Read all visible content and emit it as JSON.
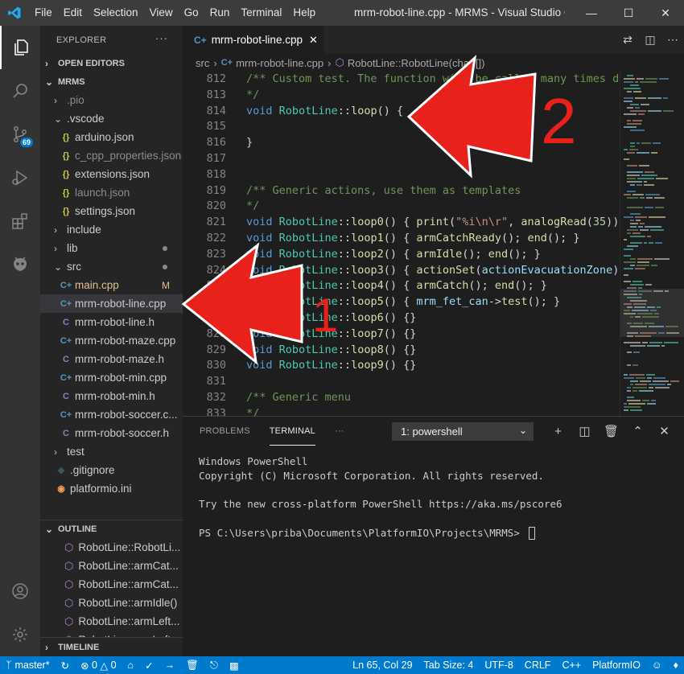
{
  "titlebar": {
    "menu": [
      "File",
      "Edit",
      "Selection",
      "View",
      "Go",
      "Run",
      "Terminal",
      "Help"
    ],
    "window_title": "mrm-robot-line.cpp - MRMS - Visual Studio C..."
  },
  "activitybar": {
    "scm_badge": "69",
    "icons": [
      "explorer-icon",
      "search-icon",
      "source-control-icon",
      "run-debug-icon",
      "extensions-icon",
      "platformio-icon"
    ]
  },
  "sidebar": {
    "header": "EXPLORER",
    "more": "···",
    "open_editors": "OPEN EDITORS",
    "project": "MRMS",
    "tree": [
      {
        "label": ".pio",
        "type": "folder",
        "indent": 1,
        "expanded": false
      },
      {
        "label": ".vscode",
        "type": "folder",
        "indent": 1,
        "expanded": true
      },
      {
        "label": "arduino.json",
        "type": "json",
        "indent": 2
      },
      {
        "label": "c_cpp_properties.json",
        "type": "json",
        "indent": 2
      },
      {
        "label": "extensions.json",
        "type": "json",
        "indent": 2
      },
      {
        "label": "launch.json",
        "type": "json",
        "indent": 2
      },
      {
        "label": "settings.json",
        "type": "json",
        "indent": 2
      },
      {
        "label": "include",
        "type": "folder",
        "indent": 1,
        "expanded": false
      },
      {
        "label": "lib",
        "type": "folder",
        "indent": 1,
        "expanded": false,
        "dot": true
      },
      {
        "label": "src",
        "type": "folder",
        "indent": 1,
        "expanded": true,
        "dot": true
      },
      {
        "label": "main.cpp",
        "type": "cpp",
        "indent": 2,
        "status": "M"
      },
      {
        "label": "mrm-robot-line.cpp",
        "type": "cpp",
        "indent": 2,
        "selected": true
      },
      {
        "label": "mrm-robot-line.h",
        "type": "h",
        "indent": 2
      },
      {
        "label": "mrm-robot-maze.cpp",
        "type": "cpp",
        "indent": 2
      },
      {
        "label": "mrm-robot-maze.h",
        "type": "h",
        "indent": 2
      },
      {
        "label": "mrm-robot-min.cpp",
        "type": "cpp",
        "indent": 2
      },
      {
        "label": "mrm-robot-min.h",
        "type": "h",
        "indent": 2
      },
      {
        "label": "mrm-robot-soccer.c...",
        "type": "cpp",
        "indent": 2
      },
      {
        "label": "mrm-robot-soccer.h",
        "type": "h",
        "indent": 2
      },
      {
        "label": "test",
        "type": "folder",
        "indent": 1,
        "expanded": false
      },
      {
        "label": ".gitignore",
        "type": "git",
        "indent": 1
      },
      {
        "label": "platformio.ini",
        "type": "ini",
        "indent": 1
      }
    ],
    "outline_title": "OUTLINE",
    "outline": [
      "RobotLine::RobotLi...",
      "RobotLine::armCat...",
      "RobotLine::armCat...",
      "RobotLine::armIdle()",
      "RobotLine::armLeft...",
      "RobotLine::armLeft..."
    ],
    "timeline_title": "TIMELINE"
  },
  "editor": {
    "tab_label": "mrm-robot-line.cpp",
    "tab_close": "✕",
    "breadcrumb": [
      "src",
      "mrm-robot-line.cpp",
      "RobotLine::RobotLine(char [])"
    ],
    "lines": [
      {
        "n": "812",
        "t": [
          [
            "cm",
            "/** Custom test. The function will be called many times du"
          ]
        ]
      },
      {
        "n": "813",
        "t": [
          [
            "cm",
            "*/"
          ]
        ]
      },
      {
        "n": "814",
        "t": [
          [
            "kw",
            "void "
          ],
          [
            "ty",
            "RobotLine"
          ],
          [
            "tx",
            "::"
          ],
          [
            "fn",
            "loop"
          ],
          [
            "tx",
            "() {"
          ]
        ]
      },
      {
        "n": "815",
        "t": []
      },
      {
        "n": "816",
        "t": [
          [
            "tx",
            "}"
          ]
        ]
      },
      {
        "n": "817",
        "t": []
      },
      {
        "n": "818",
        "t": []
      },
      {
        "n": "819",
        "t": [
          [
            "cm",
            "/** Generic actions, use them as templates"
          ]
        ]
      },
      {
        "n": "820",
        "t": [
          [
            "cm",
            "*/"
          ]
        ]
      },
      {
        "n": "821",
        "t": [
          [
            "kw",
            "void "
          ],
          [
            "ty",
            "RobotLine"
          ],
          [
            "tx",
            "::"
          ],
          [
            "fn",
            "loop0"
          ],
          [
            "tx",
            "() { "
          ],
          [
            "fn",
            "print"
          ],
          [
            "tx",
            "("
          ],
          [
            "st",
            "\"%i\\n\\r\""
          ],
          [
            "tx",
            ", "
          ],
          [
            "fn",
            "analogRead"
          ],
          [
            "tx",
            "("
          ],
          [
            "nm",
            "35"
          ],
          [
            "tx",
            "))"
          ]
        ]
      },
      {
        "n": "822",
        "t": [
          [
            "kw",
            "void "
          ],
          [
            "ty",
            "RobotLine"
          ],
          [
            "tx",
            "::"
          ],
          [
            "fn",
            "loop1"
          ],
          [
            "tx",
            "() { "
          ],
          [
            "fn",
            "armCatchReady"
          ],
          [
            "tx",
            "(); "
          ],
          [
            "fn",
            "end"
          ],
          [
            "tx",
            "(); }"
          ]
        ]
      },
      {
        "n": "823",
        "t": [
          [
            "kw",
            "void "
          ],
          [
            "ty",
            "RobotLine"
          ],
          [
            "tx",
            "::"
          ],
          [
            "fn",
            "loop2"
          ],
          [
            "tx",
            "() { "
          ],
          [
            "fn",
            "armIdle"
          ],
          [
            "tx",
            "(); "
          ],
          [
            "fn",
            "end"
          ],
          [
            "tx",
            "(); }"
          ]
        ]
      },
      {
        "n": "824",
        "t": [
          [
            "kw",
            "void "
          ],
          [
            "ty",
            "RobotLine"
          ],
          [
            "tx",
            "::"
          ],
          [
            "fn",
            "loop3"
          ],
          [
            "tx",
            "() { "
          ],
          [
            "fn",
            "actionSet"
          ],
          [
            "tx",
            "("
          ],
          [
            "vr",
            "actionEvacuationZone"
          ],
          [
            "tx",
            ")"
          ]
        ]
      },
      {
        "n": "825",
        "t": [
          [
            "kw",
            "void "
          ],
          [
            "ty",
            "RobotLine"
          ],
          [
            "tx",
            "::"
          ],
          [
            "fn",
            "loop4"
          ],
          [
            "tx",
            "() { "
          ],
          [
            "fn",
            "armCatch"
          ],
          [
            "tx",
            "(); "
          ],
          [
            "fn",
            "end"
          ],
          [
            "tx",
            "(); }"
          ]
        ]
      },
      {
        "n": "826",
        "t": [
          [
            "kw",
            "void "
          ],
          [
            "ty",
            "RobotLine"
          ],
          [
            "tx",
            "::"
          ],
          [
            "fn",
            "loop5"
          ],
          [
            "tx",
            "() { "
          ],
          [
            "vr",
            "mrm_fet_can"
          ],
          [
            "tx",
            "->"
          ],
          [
            "fn",
            "test"
          ],
          [
            "tx",
            "(); }"
          ]
        ]
      },
      {
        "n": "827",
        "t": [
          [
            "kw",
            "void "
          ],
          [
            "ty",
            "RobotLine"
          ],
          [
            "tx",
            "::"
          ],
          [
            "fn",
            "loop6"
          ],
          [
            "tx",
            "() {}"
          ]
        ]
      },
      {
        "n": "828",
        "t": [
          [
            "kw",
            "void "
          ],
          [
            "ty",
            "RobotLine"
          ],
          [
            "tx",
            "::"
          ],
          [
            "fn",
            "loop7"
          ],
          [
            "tx",
            "() {}"
          ]
        ]
      },
      {
        "n": "829",
        "t": [
          [
            "kw",
            "void "
          ],
          [
            "ty",
            "RobotLine"
          ],
          [
            "tx",
            "::"
          ],
          [
            "fn",
            "loop8"
          ],
          [
            "tx",
            "() {}"
          ]
        ]
      },
      {
        "n": "830",
        "t": [
          [
            "kw",
            "void "
          ],
          [
            "ty",
            "RobotLine"
          ],
          [
            "tx",
            "::"
          ],
          [
            "fn",
            "loop9"
          ],
          [
            "tx",
            "() {}"
          ]
        ]
      },
      {
        "n": "831",
        "t": []
      },
      {
        "n": "832",
        "t": [
          [
            "cm",
            "/** Generic menu"
          ]
        ]
      },
      {
        "n": "833",
        "t": [
          [
            "cm",
            "*/"
          ]
        ]
      }
    ]
  },
  "panel": {
    "tabs": [
      "PROBLEMS",
      "TERMINAL",
      "···"
    ],
    "active_tab": "TERMINAL",
    "terminal_select": "1: powershell",
    "terminal_lines": [
      "Windows PowerShell",
      "Copyright (C) Microsoft Corporation. All rights reserved.",
      "",
      "Try the new cross-platform PowerShell https://aka.ms/pscore6",
      "",
      "PS C:\\Users\\priba\\Documents\\PlatformIO\\Projects\\MRMS> "
    ]
  },
  "statusbar": {
    "branch": "master*",
    "errors": "0",
    "warnings": "0",
    "position": "Ln 65, Col 29",
    "tab_size": "Tab Size: 4",
    "encoding": "UTF-8",
    "eol": "CRLF",
    "language": "C++",
    "platform": "PlatformIO"
  },
  "annotations": {
    "arrow1_label": "1",
    "arrow2_label": "2",
    "color": "#e8221b"
  }
}
